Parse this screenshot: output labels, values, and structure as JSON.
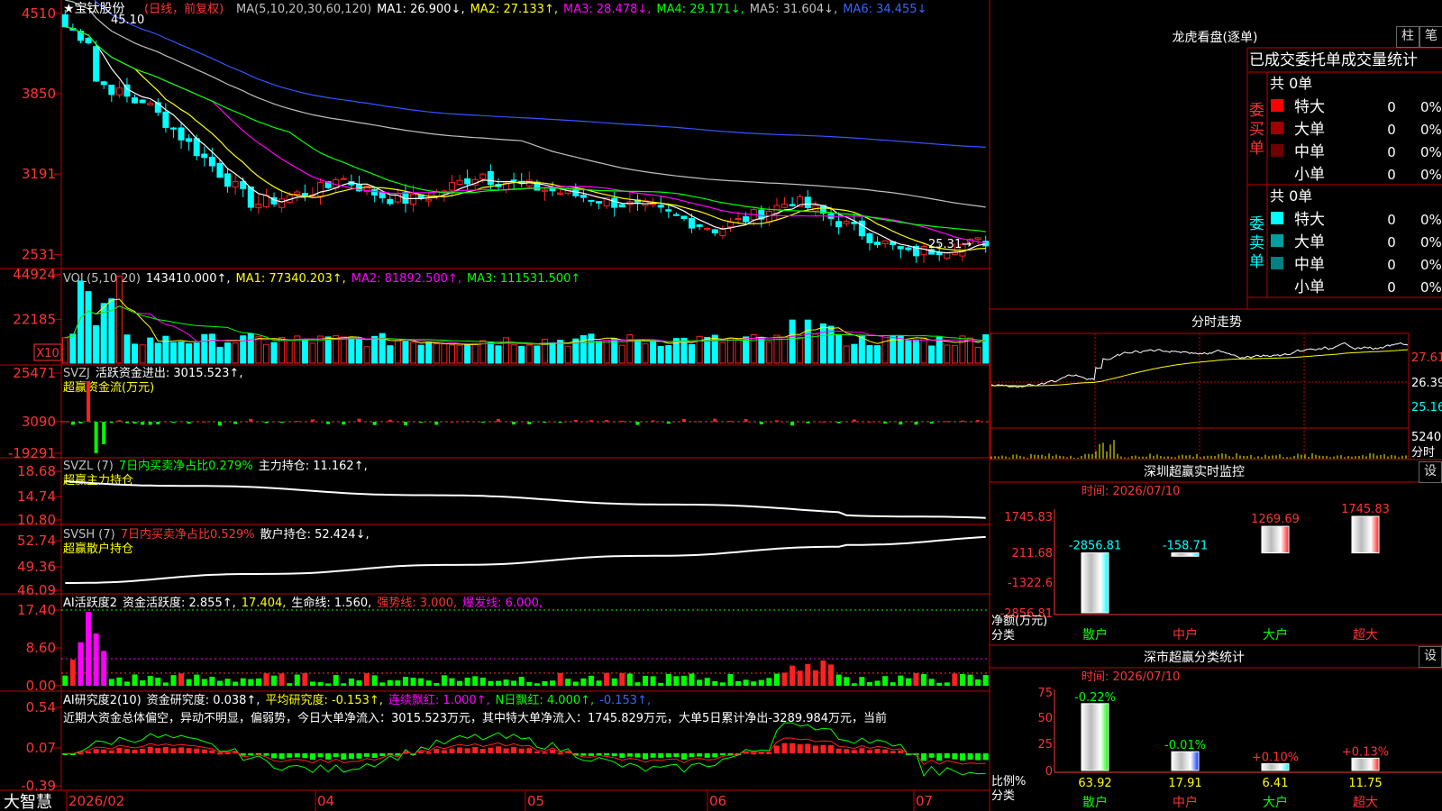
{
  "stock": {
    "title": "★宝钛股份",
    "mode": "(日线，前复权)"
  },
  "ma_line": [
    {
      "text": "MA(5,10,20,30,60,120)",
      "color": "#c0c0c0"
    },
    {
      "text": "MA1: 26.900↓,",
      "color": "#ffffff"
    },
    {
      "text": "MA2: 27.133↑,",
      "color": "#ffff00"
    },
    {
      "text": "MA3: 28.478↓,",
      "color": "#ff00ff"
    },
    {
      "text": "MA4: 29.171↓,",
      "color": "#00ff00"
    },
    {
      "text": "MA5: 31.604↓,",
      "color": "#c0c0c0"
    },
    {
      "text": "MA6: 34.455↓",
      "color": "#3366ff"
    }
  ],
  "price_axis": [
    "4510",
    "3850",
    "3191",
    "2531"
  ],
  "price_marks": {
    "high": "45.10",
    "low": "25.31→"
  },
  "vol": {
    "header": [
      {
        "text": "VOL(5,10,20)",
        "color": "#c0c0c0"
      },
      {
        "text": "143410.000↑,",
        "color": "#ffffff"
      },
      {
        "text": "MA1: 77340.203↑,",
        "color": "#ffff00"
      },
      {
        "text": "MA2: 81892.500↑,",
        "color": "#ff00ff"
      },
      {
        "text": "MA3: 111531.500↑",
        "color": "#00ff00"
      }
    ],
    "axis": [
      "44924",
      "22185"
    ],
    "unit": "X10"
  },
  "svzj": {
    "header": [
      {
        "text": "SVZJ",
        "color": "#c0c0c0"
      },
      {
        "text": "活跃资金进出: 3015.523↑,",
        "color": "#ffffff"
      }
    ],
    "sub": "超赢资金流(万元)",
    "axis": [
      "25471",
      "3090",
      "-19291"
    ]
  },
  "svzl": {
    "header": [
      {
        "text": "SVZL (7)",
        "color": "#c0c0c0"
      },
      {
        "text": "7日内买卖净占比0.279%",
        "color": "#00ff00"
      },
      {
        "text": "主力持仓: 11.162↑,",
        "color": "#ffffff"
      }
    ],
    "sub": "超赢主力持仓",
    "axis": [
      "18.68",
      "14.74",
      "10.80"
    ]
  },
  "svsh": {
    "header": [
      {
        "text": "SVSH (7)",
        "color": "#c0c0c0"
      },
      {
        "text": "7日内买卖净占比0.529%",
        "color": "#ff3333"
      },
      {
        "text": "散户持仓: 52.424↓,",
        "color": "#ffffff"
      }
    ],
    "sub": "超赢散户持仓",
    "axis": [
      "52.74",
      "49.36",
      "46.09"
    ]
  },
  "ai1": {
    "header": [
      {
        "text": "AI活跃度2",
        "color": "#ffffff"
      },
      {
        "text": "资金活跃度: 2.855↑,",
        "color": "#ffffff"
      },
      {
        "text": "17.404,",
        "color": "#ffff00"
      },
      {
        "text": "生命线: 1.560,",
        "color": "#ffffff"
      },
      {
        "text": "强势线: 3.000,",
        "color": "#ff3333"
      },
      {
        "text": "爆发线: 6.000,",
        "color": "#ff00ff"
      }
    ],
    "axis": [
      "17.40",
      "8.60",
      "0.00"
    ]
  },
  "ai2": {
    "header": [
      {
        "text": "AI研究度2(10)",
        "color": "#ffffff"
      },
      {
        "text": "资金研究度: 0.038↑,",
        "color": "#ffffff"
      },
      {
        "text": "平均研究度: -0.153↑,",
        "color": "#ffff00"
      },
      {
        "text": "连续飘红: 1.000↑,",
        "color": "#ff00ff"
      },
      {
        "text": "N日飘红: 4.000↑,",
        "color": "#00ff00"
      },
      {
        "text": "-0.153↑,",
        "color": "#3366ff"
      }
    ],
    "text": "近期大资金总体偏空，异动不明显，偏弱势，今日大单净流入：3015.523万元，其中特大单净流入：1745.829万元，大单5日累计净出-3289.984万元，当前",
    "axis": [
      "0.54",
      "0.07",
      "-0.39"
    ]
  },
  "date_axis": [
    "2026/02",
    "04",
    "05",
    "06",
    "07"
  ],
  "brand": "大智慧",
  "right": {
    "longhu_title": "龙虎看盘(逐单)",
    "btn_zhu": "柱",
    "btn_bi": "笔",
    "stat_title": "已成交委托单成交量统计",
    "buy_label": "委买单",
    "sell_label": "委卖单",
    "buy_total": "共 0单",
    "sell_total": "共 0单",
    "rows": [
      {
        "name": "特大",
        "val": "0",
        "pct": "0%"
      },
      {
        "name": "大单",
        "val": "0",
        "pct": "0%"
      },
      {
        "name": "中单",
        "val": "0",
        "pct": "0%"
      },
      {
        "name": "小单",
        "val": "0",
        "pct": "0%"
      }
    ],
    "fenshi_title": "分时走势",
    "fenshi_axis": [
      "27.61",
      "26.39",
      "25.16"
    ],
    "fenshi_vol": "5240",
    "fenshi_unit": "分时",
    "sz_title": "深圳超赢实时监控",
    "sz_time": "时间: 2026/07/10",
    "sz_axis": [
      "1745.83",
      "211.68",
      "-1322.6",
      "-2856.81"
    ],
    "sz_bars": [
      {
        "cat": "散户",
        "value": "-2856.81"
      },
      {
        "cat": "中户",
        "value": "-158.71"
      },
      {
        "cat": "大户",
        "value": "1269.69"
      },
      {
        "cat": "超大",
        "value": "1745.83"
      }
    ],
    "sz_ylabel": "净额(万元)",
    "sz_xlabel": "分类",
    "sf_title": "深市超赢分类统计",
    "sf_time": "时间: 2026/07/10",
    "sf_axis": [
      "75",
      "50",
      "25",
      "0"
    ],
    "sf_bars": [
      {
        "cat": "散户",
        "value": "63.92",
        "chg": "-0.22%"
      },
      {
        "cat": "中户",
        "value": "17.91",
        "chg": "-0.01%"
      },
      {
        "cat": "大户",
        "value": "6.41",
        "chg": "+0.10%"
      },
      {
        "cat": "超大",
        "value": "11.75",
        "chg": "+0.13%"
      }
    ],
    "sf_ylabel": "比例%",
    "sf_xlabel": "分类",
    "btn_set": "设"
  },
  "colors": {
    "up": "#ff2020",
    "down": "#00ffff",
    "grid": "#c00000",
    "axis_text": "#ff3333"
  }
}
